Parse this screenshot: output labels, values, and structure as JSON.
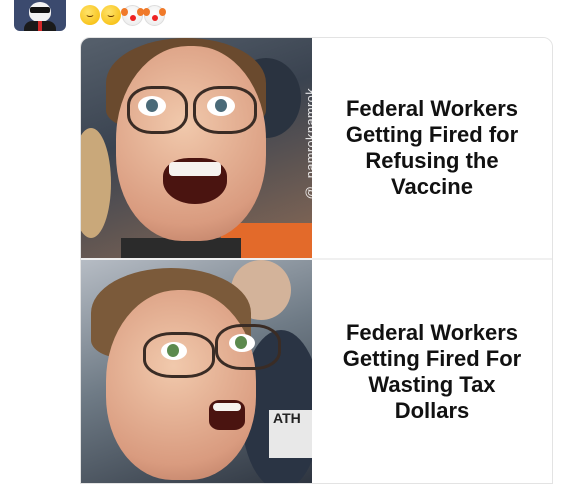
{
  "header": {
    "avatar_icon": "cartoon-man-sunglasses-avatar",
    "reactions": [
      {
        "icon": "rolling-on-floor-laughing-emoji"
      },
      {
        "icon": "rolling-on-floor-laughing-emoji"
      },
      {
        "icon": "clown-face-emoji"
      },
      {
        "icon": "clown-face-emoji"
      }
    ]
  },
  "meme": {
    "watermark": "@_namroknamrok",
    "top_caption": "Federal Workers\nGetting Fired for\nRefusing the\nVaccine",
    "bottom_caption": "Federal Workers\nGetting Fired For\nWasting Tax\nDollars",
    "sign_text": "ATH"
  },
  "colors": {
    "background": "#ffffff",
    "caption_text": "#111111",
    "card_border": "#e3e3e3"
  }
}
